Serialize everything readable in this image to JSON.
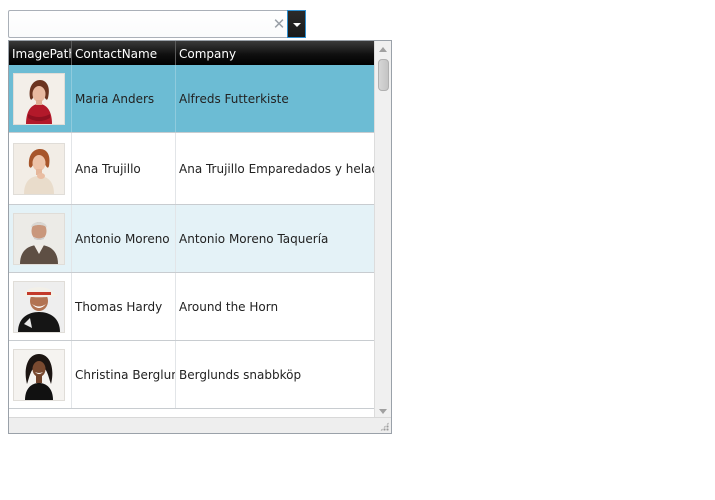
{
  "combo": {
    "value": "",
    "placeholder": "",
    "clear_icon": "clear-x-icon",
    "dropdown_icon": "chevron-down-icon"
  },
  "grid": {
    "columns": [
      "ImagePath",
      "ContactName",
      "Company"
    ],
    "rows": [
      {
        "image": "maria-anders-photo",
        "contact_name": "Maria Anders",
        "company": "Alfreds Futterkiste",
        "state": "selected"
      },
      {
        "image": "ana-trujillo-photo",
        "contact_name": "Ana Trujillo",
        "company": "Ana Trujillo Emparedados y helados",
        "state": "normal"
      },
      {
        "image": "antonio-moreno-photo",
        "contact_name": "Antonio Moreno",
        "company": "Antonio Moreno Taquería",
        "state": "hover"
      },
      {
        "image": "thomas-hardy-photo",
        "contact_name": "Thomas Hardy",
        "company": "Around the Horn",
        "state": "normal"
      },
      {
        "image": "christina-berglund-photo",
        "contact_name": "Christina Berglund",
        "company": "Berglunds snabbköp",
        "state": "normal"
      }
    ]
  },
  "colors": {
    "selected_row": "#6cbcd4",
    "hover_row": "#e4f2f7",
    "header_bg": "#000000",
    "dropdown_button_border": "#2f8fcf"
  }
}
